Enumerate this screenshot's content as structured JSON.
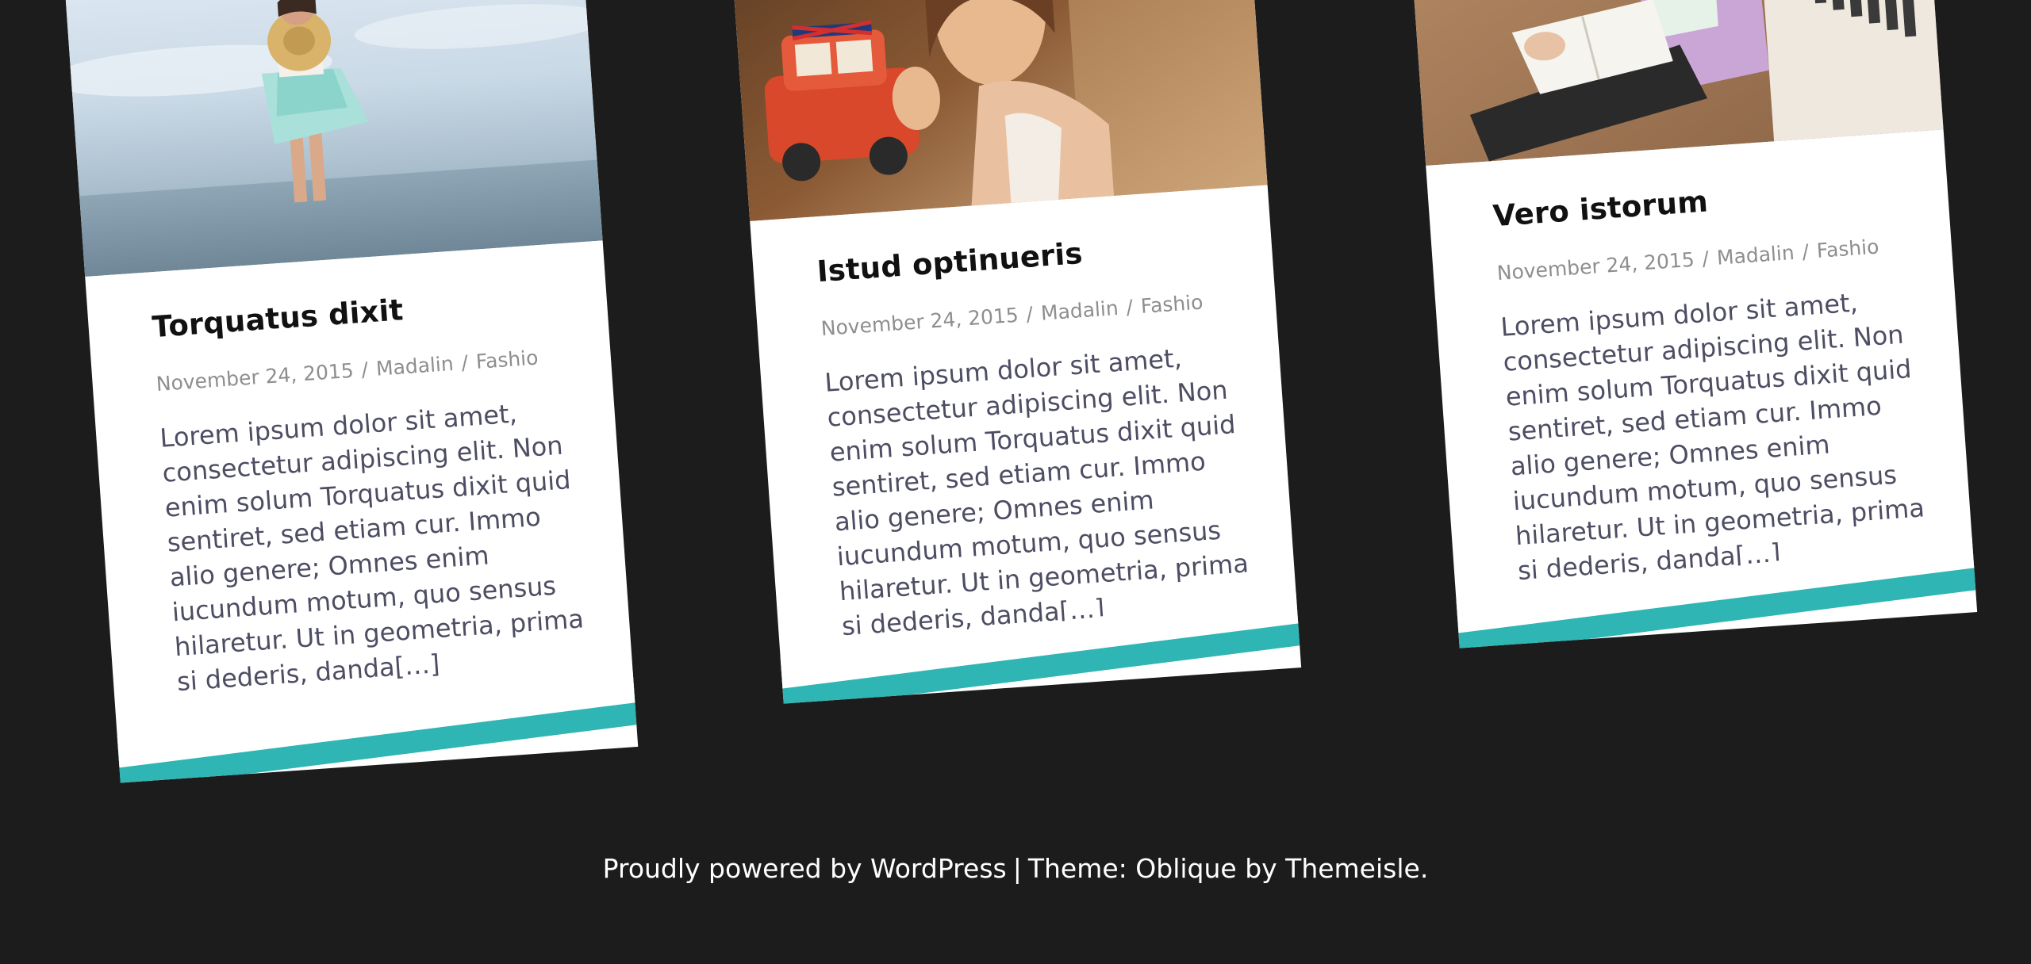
{
  "posts": [
    {
      "title": "Torquatus dixit",
      "date": "November 24, 2015",
      "author": "Madalin",
      "category": "Fashio",
      "excerpt": "Lorem ipsum dolor sit amet, consectetur adipiscing elit. Non enim solum Torquatus dixit quid sentiret, sed etiam cur. Immo alio genere; Omnes enim iucundum motum, quo sensus hilaretur. Ut in geometria, prima si dederis, danda[…]",
      "image_subject": "woman-with-hat-at-sea"
    },
    {
      "title": "Istud optinueris",
      "date": "November 24, 2015",
      "author": "Madalin",
      "category": "Fashio",
      "excerpt": "Lorem ipsum dolor sit amet, consectetur adipiscing elit. Non enim solum Torquatus dixit quid sentiret, sed etiam cur. Immo alio genere; Omnes enim iucundum motum, quo sensus hilaretur. Ut in geometria, prima si dederis, danda[…]",
      "image_subject": "woman-with-toy-car"
    },
    {
      "title": "Vero istorum",
      "date": "November 24, 2015",
      "author": "Madalin",
      "category": "Fashio",
      "excerpt": "Lorem ipsum dolor sit amet, consectetur adipiscing elit. Non enim solum Torquatus dixit quid sentiret, sed etiam cur. Immo alio genere; Omnes enim iucundum motum, quo sensus hilaretur. Ut in geometria, prima si dederis, danda[…]",
      "image_subject": "woman-reading-by-bookshelf"
    }
  ],
  "meta_separator": "/",
  "footer": {
    "powered_prefix": "Proudly powered by ",
    "powered_link": "WordPress",
    "separator": "|",
    "theme_prefix": "Theme: Oblique by ",
    "theme_link": "Themeisle",
    "theme_suffix": "."
  },
  "colors": {
    "background": "#1c1c1c",
    "accent": "#2fb5b3",
    "card": "#ffffff"
  }
}
